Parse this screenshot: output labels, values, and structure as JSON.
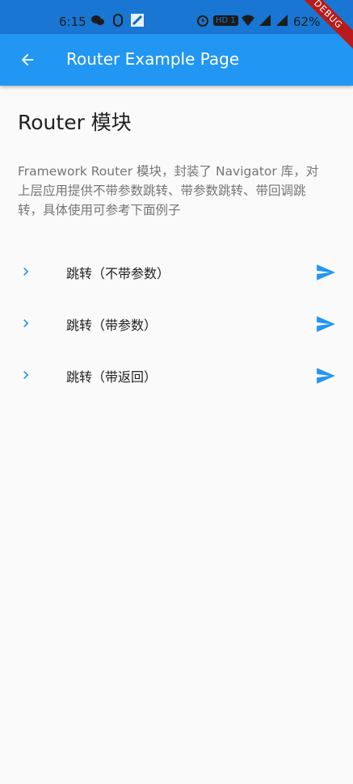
{
  "status_bar": {
    "time": "6:15",
    "hd_badge": "HD 1",
    "battery": "62%"
  },
  "app_bar": {
    "title": "Router Example Page",
    "back_icon": "arrow-back-icon"
  },
  "debug_banner": "DEBUG",
  "page": {
    "heading": "Router 模块",
    "description": "Framework Router 模块，封装了 Navigator 库，对上层应用提供不带参数跳转、带参数跳转、带回调跳转，具体使用可参考下面例子"
  },
  "list": {
    "items": [
      {
        "label": "跳转（不带参数）",
        "lead_icon": "chevron-right-icon",
        "trail_icon": "send-icon"
      },
      {
        "label": "跳转（带参数）",
        "lead_icon": "chevron-right-icon",
        "trail_icon": "send-icon"
      },
      {
        "label": "跳转（带返回）",
        "lead_icon": "chevron-right-icon",
        "trail_icon": "send-icon"
      }
    ]
  },
  "colors": {
    "primary": "#2196f3",
    "status_bar": "#1976d2",
    "icon_accent": "#2196f3"
  }
}
